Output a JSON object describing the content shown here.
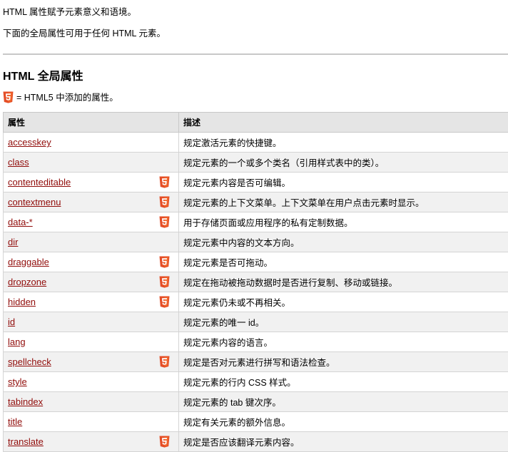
{
  "intro": {
    "line1": "HTML 属性赋予元素意义和语境。",
    "line2": "下面的全局属性可用于任何 HTML 元素。"
  },
  "section": {
    "title": "HTML 全局属性",
    "legend_text": "= HTML5 中添加的属性。",
    "legend_icon": "html5-icon"
  },
  "table": {
    "headers": [
      "属性",
      "描述"
    ],
    "rows": [
      {
        "attr": "accesskey",
        "html5": false,
        "desc": "规定激活元素的快捷键。"
      },
      {
        "attr": "class",
        "html5": false,
        "desc": "规定元素的一个或多个类名（引用样式表中的类）。"
      },
      {
        "attr": "contenteditable",
        "html5": true,
        "desc": "规定元素内容是否可编辑。"
      },
      {
        "attr": "contextmenu",
        "html5": true,
        "desc": "规定元素的上下文菜单。上下文菜单在用户点击元素时显示。"
      },
      {
        "attr": "data-*",
        "html5": true,
        "desc": "用于存储页面或应用程序的私有定制数据。"
      },
      {
        "attr": "dir",
        "html5": false,
        "desc": "规定元素中内容的文本方向。"
      },
      {
        "attr": "draggable",
        "html5": true,
        "desc": "规定元素是否可拖动。"
      },
      {
        "attr": "dropzone",
        "html5": true,
        "desc": "规定在拖动被拖动数据时是否进行复制、移动或链接。"
      },
      {
        "attr": "hidden",
        "html5": true,
        "desc": "规定元素仍未或不再相关。"
      },
      {
        "attr": "id",
        "html5": false,
        "desc": "规定元素的唯一 id。"
      },
      {
        "attr": "lang",
        "html5": false,
        "desc": "规定元素内容的语言。"
      },
      {
        "attr": "spellcheck",
        "html5": true,
        "desc": "规定是否对元素进行拼写和语法检查。"
      },
      {
        "attr": "style",
        "html5": false,
        "desc": "规定元素的行内 CSS 样式。"
      },
      {
        "attr": "tabindex",
        "html5": false,
        "desc": "规定元素的 tab 键次序。"
      },
      {
        "attr": "title",
        "html5": false,
        "desc": "规定有关元素的额外信息。"
      },
      {
        "attr": "translate",
        "html5": true,
        "desc": "规定是否应该翻译元素内容。"
      }
    ]
  },
  "colors": {
    "link": "#900b09",
    "html5_badge": "#e44d26"
  }
}
